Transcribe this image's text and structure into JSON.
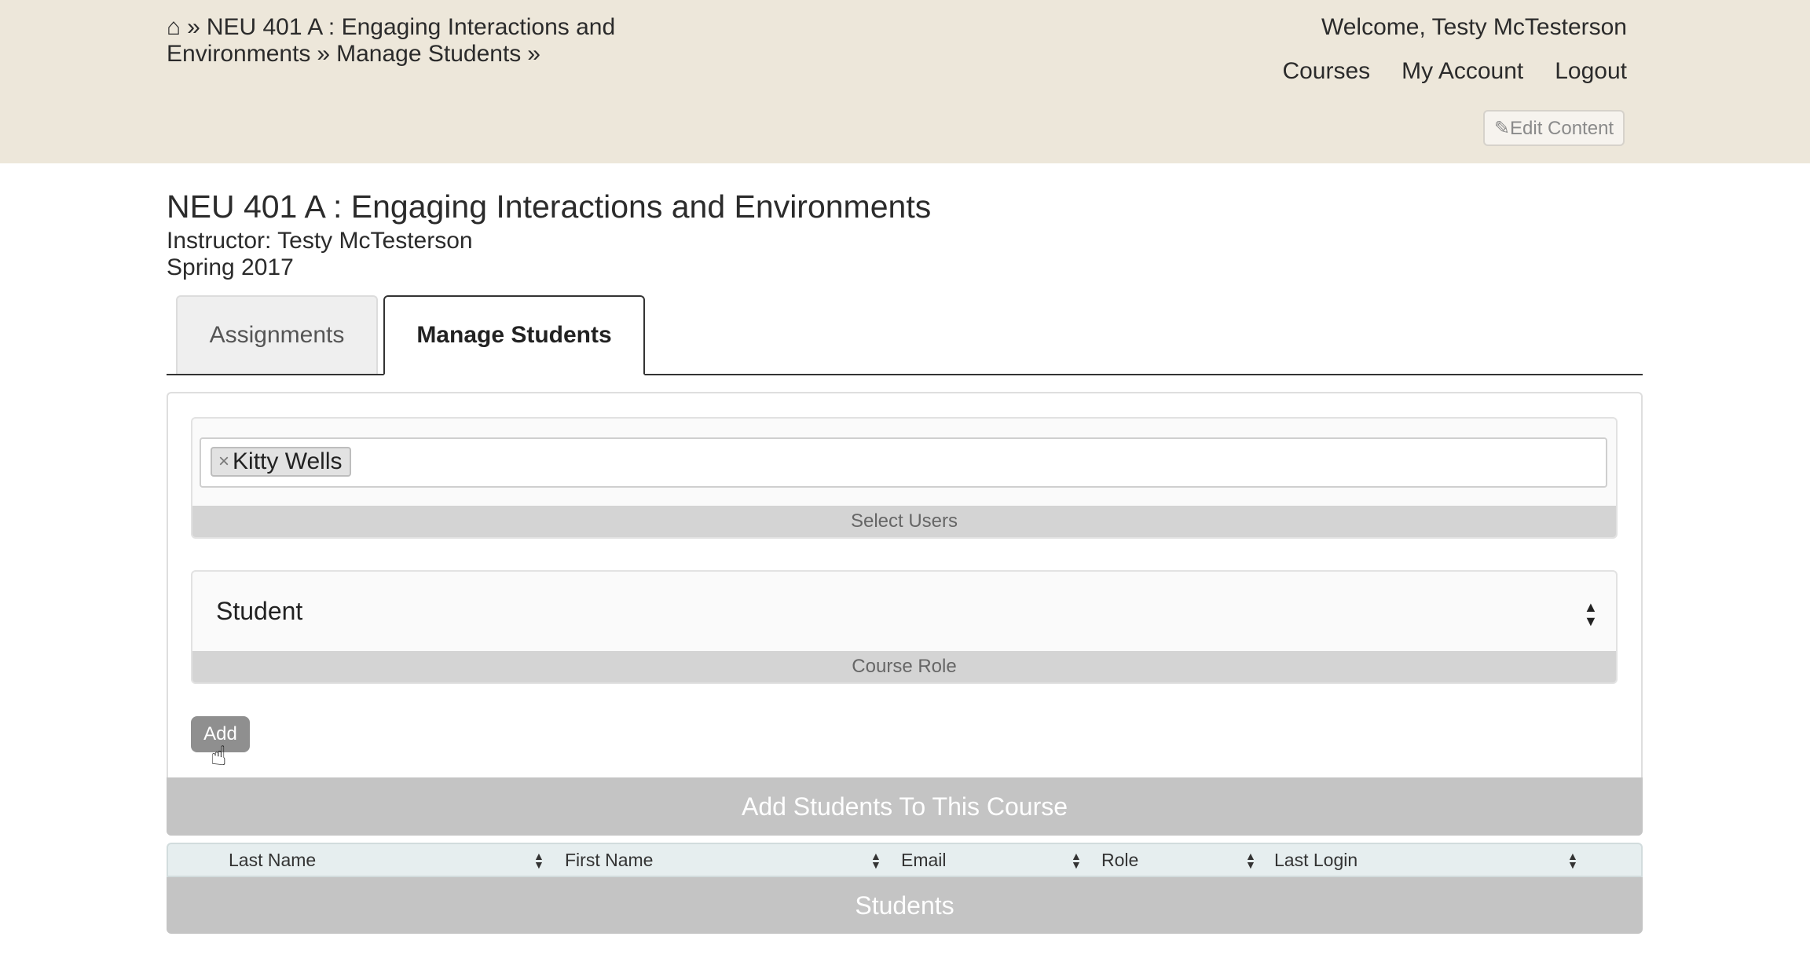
{
  "header": {
    "breadcrumb": {
      "home": "⌂",
      "sep": "»",
      "course": "NEU 401 A : Engaging Interactions and Environments",
      "page": "Manage Students"
    },
    "welcome": "Welcome, Testy McTesterson",
    "nav": [
      "Courses",
      "My Account",
      "Logout"
    ],
    "edit_content": "✎Edit Content"
  },
  "course": {
    "title": "NEU 401 A : Engaging Interactions and Environments",
    "instructor": "Instructor: Testy McTesterson",
    "term": "Spring 2017"
  },
  "tabs": [
    {
      "label": "Assignments",
      "active": false
    },
    {
      "label": "Manage Students",
      "active": true
    }
  ],
  "form": {
    "selected_users": [
      {
        "name": "Kitty Wells",
        "remove": "×"
      }
    ],
    "select_users_label": "Select Users",
    "course_role": "Student",
    "course_role_label": "Course Role",
    "add_button": "Add",
    "section_title": "Add Students To This Course"
  },
  "students_table": {
    "columns": [
      "Last Name",
      "First Name",
      "Email",
      "Role",
      "Last Login"
    ],
    "rows": [],
    "title": "Students"
  }
}
